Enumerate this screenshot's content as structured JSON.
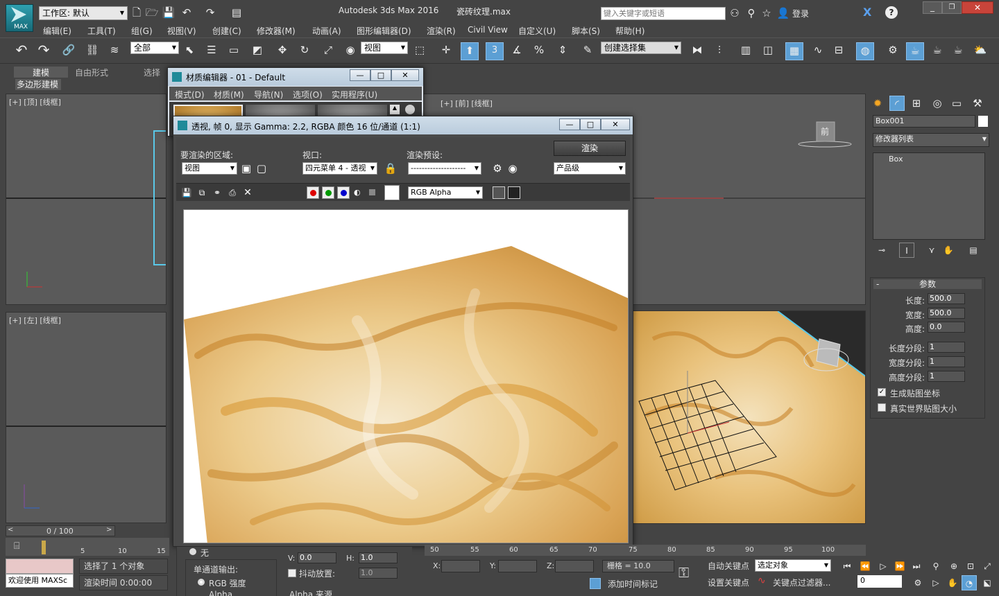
{
  "app": {
    "title": "Autodesk 3ds Max 2016",
    "file": "瓷砖纹理.max",
    "logo": "MAX",
    "workspace_label": "工作区: 默认",
    "search_placeholder": "键入关键字或短语",
    "login": "登录"
  },
  "menu": [
    "编辑(E)",
    "工具(T)",
    "组(G)",
    "视图(V)",
    "创建(C)",
    "修改器(M)",
    "动画(A)",
    "图形编辑器(D)",
    "渲染(R)",
    "Civil View",
    "自定义(U)",
    "脚本(S)",
    "帮助(H)"
  ],
  "toolbar": {
    "filter": "全部",
    "ref_coord": "视图",
    "named_sel": "创建选择集",
    "snap_num": "3"
  },
  "ribbon": {
    "tabs": [
      "建模",
      "自由形式",
      "选择"
    ],
    "sub": "多边形建模"
  },
  "viewports": {
    "top": "[+] [顶] [线框]",
    "front": "[+] [前] [线框]",
    "left": "[+] [左] [线框]",
    "front_cube": "前"
  },
  "material_editor": {
    "title": "材质编辑器 - 01 - Default",
    "menus": [
      "模式(D)",
      "材质(M)",
      "导航(N)",
      "选项(O)",
      "实用程序(U)"
    ]
  },
  "render_window": {
    "title": "透视, 帧 0, 显示 Gamma: 2.2, RGBA 颜色 16 位/通道 (1:1)",
    "area_label": "要渲染的区域:",
    "area_value": "视图",
    "viewport_label": "视口:",
    "viewport_value": "四元菜单 4 - 透视",
    "preset_label": "渲染预设:",
    "preset_value": "--------------------",
    "render_button": "渲染",
    "quality": "产品级",
    "channel": "RGB Alpha"
  },
  "command_panel": {
    "object_name": "Box001",
    "modifier_list": "修改器列表",
    "stack_item": "Box",
    "rollout": "参数",
    "params": [
      {
        "label": "长度:",
        "value": "500.0"
      },
      {
        "label": "宽度:",
        "value": "500.0"
      },
      {
        "label": "高度:",
        "value": "0.0"
      },
      {
        "label": "长度分段:",
        "value": "1"
      },
      {
        "label": "宽度分段:",
        "value": "1"
      },
      {
        "label": "高度分段:",
        "value": "1"
      }
    ],
    "checks": [
      {
        "label": "生成贴图坐标",
        "checked": true
      },
      {
        "label": "真实世界贴图大小",
        "checked": false
      }
    ]
  },
  "timeline": {
    "frame": "0 / 100",
    "ticks_left": [
      "5",
      "10",
      "15"
    ],
    "ticks_right": [
      "50",
      "55",
      "60",
      "65",
      "70",
      "75",
      "80",
      "85",
      "90",
      "95",
      "100"
    ]
  },
  "status": {
    "welcome": "欢迎使用 MAXSc",
    "selected": "选择了 1 个对象",
    "render_time": "渲染时间 0:00:00",
    "x": "X:",
    "y": "Y:",
    "z": "Z:",
    "grid": "栅格 = 10.0",
    "add_tag": "添加时间标记",
    "auto_key": "自动关键点",
    "set_key": "设置关键点",
    "sel_obj": "选定对象",
    "key_filter": "关键点过滤器...",
    "frame_field": "0"
  },
  "under_panel": {
    "none": "无",
    "single_output": "单通道输出:",
    "rgb": "RGB 强度",
    "alpha": "Alpha",
    "v": "V:",
    "v_val": "0.0",
    "h": "H:",
    "h_val": "1.0",
    "dither": "抖动放置:",
    "dither_val": "1.0",
    "alpha_src": "Alpha 来源"
  }
}
